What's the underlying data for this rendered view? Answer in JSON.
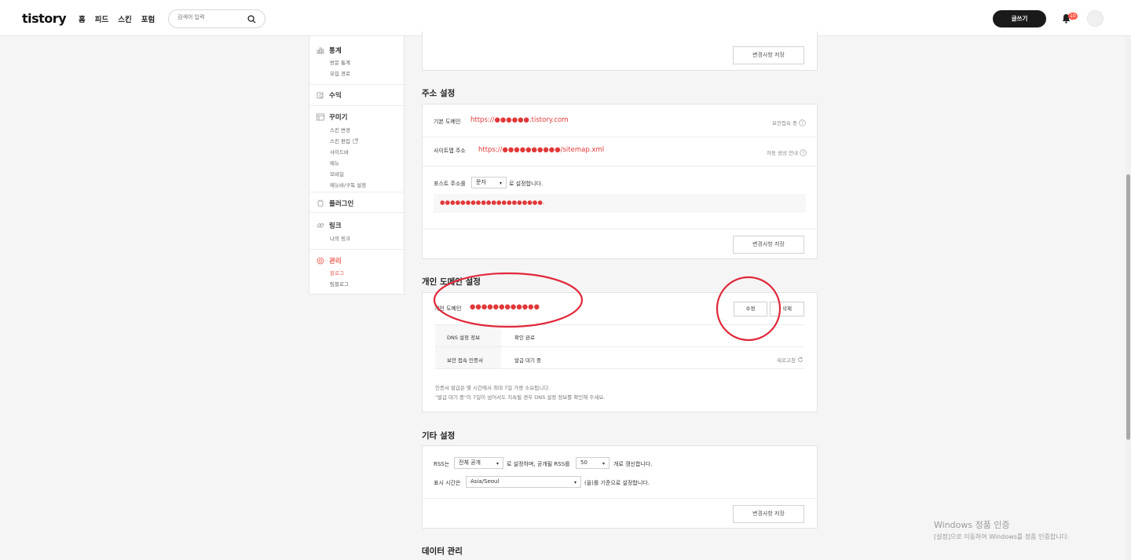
{
  "header": {
    "logo": "tistory",
    "nav": [
      "홈",
      "피드",
      "스킨",
      "포럼"
    ],
    "search_placeholder": "검색어 입력",
    "write_label": "글쓰기",
    "notification_count": "10"
  },
  "sidebar": {
    "stats": {
      "label": "통계",
      "items": [
        "방문 통계",
        "유입 경로"
      ]
    },
    "revenue": {
      "label": "수익"
    },
    "design": {
      "label": "꾸미기",
      "items": [
        "스킨 변경",
        "스킨 편집",
        "사이드바",
        "메뉴",
        "모바일",
        "메뉴바/구독 설정"
      ]
    },
    "plugin": {
      "label": "플러그인"
    },
    "link": {
      "label": "링크",
      "items": [
        "나의 링크"
      ]
    },
    "manage": {
      "label": "관리",
      "items": [
        "블로그",
        "팀블로그"
      ]
    }
  },
  "top_card": {
    "save_label": "변경사항 저장"
  },
  "address": {
    "title": "주소 설정",
    "basic_domain_label": "기본 도메인",
    "basic_domain_value": "https://●●●●●●.tistory.com",
    "secure_label": "보안접속 중",
    "sitemap_label": "사이트맵 주소",
    "sitemap_value": "https://●●●●●●●●●●/sitemap.xml",
    "auto_gen_label": "자동 생성 안내",
    "post_addr_prefix": "포스트 주소를",
    "post_addr_select": "문자",
    "post_addr_suffix": "로 설정합니다.",
    "post_addr_example": "●●●●●●●●●●●●●●●●●●●●.",
    "save_label": "변경사항 저장"
  },
  "custom_domain": {
    "title": "개인 도메인 설정",
    "label": "개인 도메인",
    "value": "●●●●●●●●●●●●",
    "edit_label": "수정",
    "delete_label": "삭제",
    "dns_label": "DNS 설정 정보",
    "dns_value": "확인 완료",
    "cert_label": "보안 접속 인증서",
    "cert_value": "발급 대기 중",
    "refresh_label": "새로고침",
    "note1": "인증서 발급은 몇 시간에서 최대 7일 가량 소요됩니다.",
    "note2": "\"발급 대기 중\"이 7일이 넘어서도 지속될 경우 DNS 설정 정보를 확인해 주세요."
  },
  "other": {
    "title": "기타 설정",
    "rss_prefix": "RSS는",
    "rss_select": "전체 공개",
    "rss_middle": "로 설정하며, 공개될 RSS를",
    "rss_count": "50",
    "rss_suffix": "개로 갱신합니다.",
    "tz_prefix": "표시 시간은",
    "tz_select": "Asia/Seoul",
    "tz_suffix": "(을)를 기준으로 설정합니다.",
    "save_label": "변경사항 저장"
  },
  "data": {
    "title": "데이터 관리"
  },
  "watermark": {
    "line1": "Windows 정품 인증",
    "line2": "[설정]으로 이동하여 Windows를 정품 인증합니다."
  },
  "colors": {
    "accent": "#ef5a52",
    "annotation": "#e0283a",
    "dark": "#1a1a1a"
  }
}
